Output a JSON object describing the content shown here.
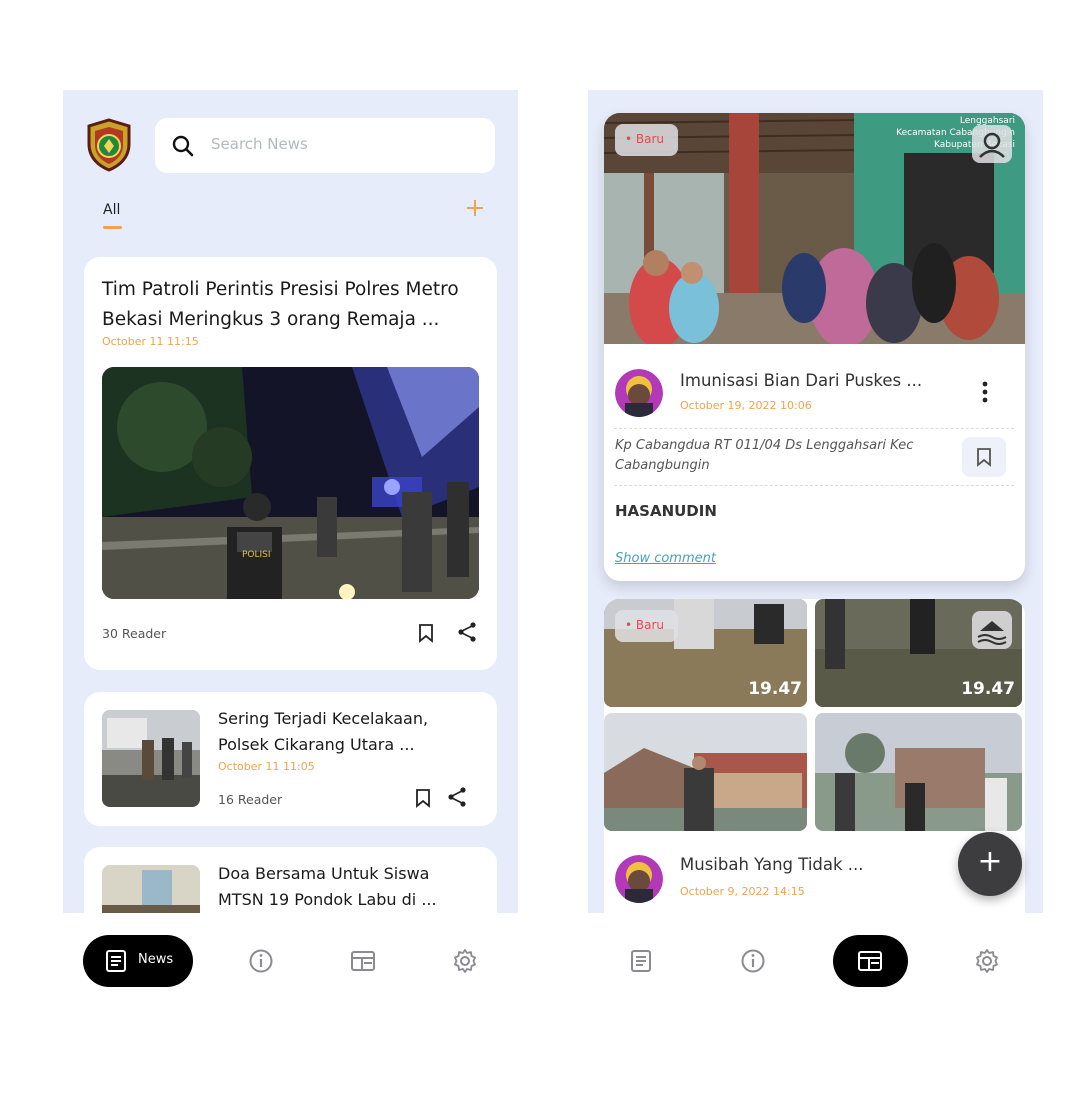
{
  "left": {
    "search": {
      "placeholder": "Search News"
    },
    "tabs": {
      "all": "All"
    },
    "featured": {
      "title": "Tim Patroli Perintis Presisi Polres Metro Bekasi Meringkus 3 orang Remaja ...",
      "date": "October 11 11:15",
      "reader": "30 Reader",
      "vest_text": "POLISI"
    },
    "list": [
      {
        "title": "Sering Terjadi Kecelakaan, Polsek Cikarang Utara ...",
        "date": "October 11 11:05",
        "reader": "16 Reader"
      },
      {
        "title": "Doa Bersama Untuk Siswa MTSN 19 Pondok Labu di ..."
      }
    ],
    "nav": {
      "news_label": "News",
      "active": "news"
    }
  },
  "right": {
    "post1": {
      "badge": "• Baru",
      "overlay_lines": [
        "Lenggahsari",
        "Kecamatan Cabangbungin",
        "Kabupaten Bekasi"
      ],
      "title": "Imunisasi Bian Dari Puskes ...",
      "date": "October 19, 2022 10:06",
      "address": "Kp Cabangdua RT 011/04 Ds Lenggahsari Kec Cabangbungin",
      "author": "HASANUDIN",
      "comment_link": "Show comment"
    },
    "post2": {
      "badge": "• Baru",
      "times": [
        "19.47",
        "19.47"
      ],
      "title": "Musibah Yang Tidak ...",
      "date": "October 9, 2022 14:15"
    },
    "nav": {
      "active": "posts"
    }
  },
  "colors": {
    "accent": "#f0a34c",
    "background": "#e7ecfa",
    "badge_text": "#e24b4b",
    "link": "#4a9fc3"
  },
  "icons": [
    "police-badge-logo",
    "search-icon",
    "plus-icon",
    "bookmark-icon",
    "share-icon",
    "news-icon",
    "info-icon",
    "feed-icon",
    "gear-icon",
    "more-vert-icon",
    "map-icon",
    "fab-plus-icon"
  ]
}
